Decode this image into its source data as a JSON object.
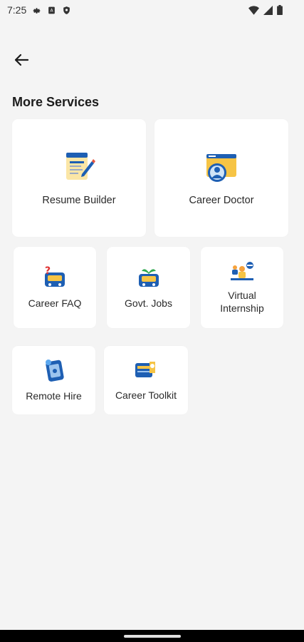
{
  "status_bar": {
    "time": "7:25",
    "icons": [
      "settings-icon",
      "sim-alert-icon",
      "shield-icon",
      "wifi-icon",
      "signal-icon",
      "battery-icon"
    ]
  },
  "header": {
    "back_icon": "arrow-left-icon"
  },
  "section": {
    "title": "More Services"
  },
  "services": [
    {
      "label": "Resume Builder",
      "icon": "resume-builder-icon"
    },
    {
      "label": "Career Doctor",
      "icon": "career-doctor-icon"
    },
    {
      "label": "Career FAQ",
      "icon": "career-faq-icon"
    },
    {
      "label": "Govt. Jobs",
      "icon": "govt-jobs-icon"
    },
    {
      "label": "Virtual Internship",
      "icon": "virtual-internship-icon"
    },
    {
      "label": "Remote Hire",
      "icon": "remote-hire-icon"
    },
    {
      "label": "Career Toolkit",
      "icon": "career-toolkit-icon"
    }
  ],
  "colors": {
    "background": "#f4f4f4",
    "card": "#ffffff",
    "accent_blue": "#1e5fb3",
    "accent_yellow": "#f6c445"
  }
}
